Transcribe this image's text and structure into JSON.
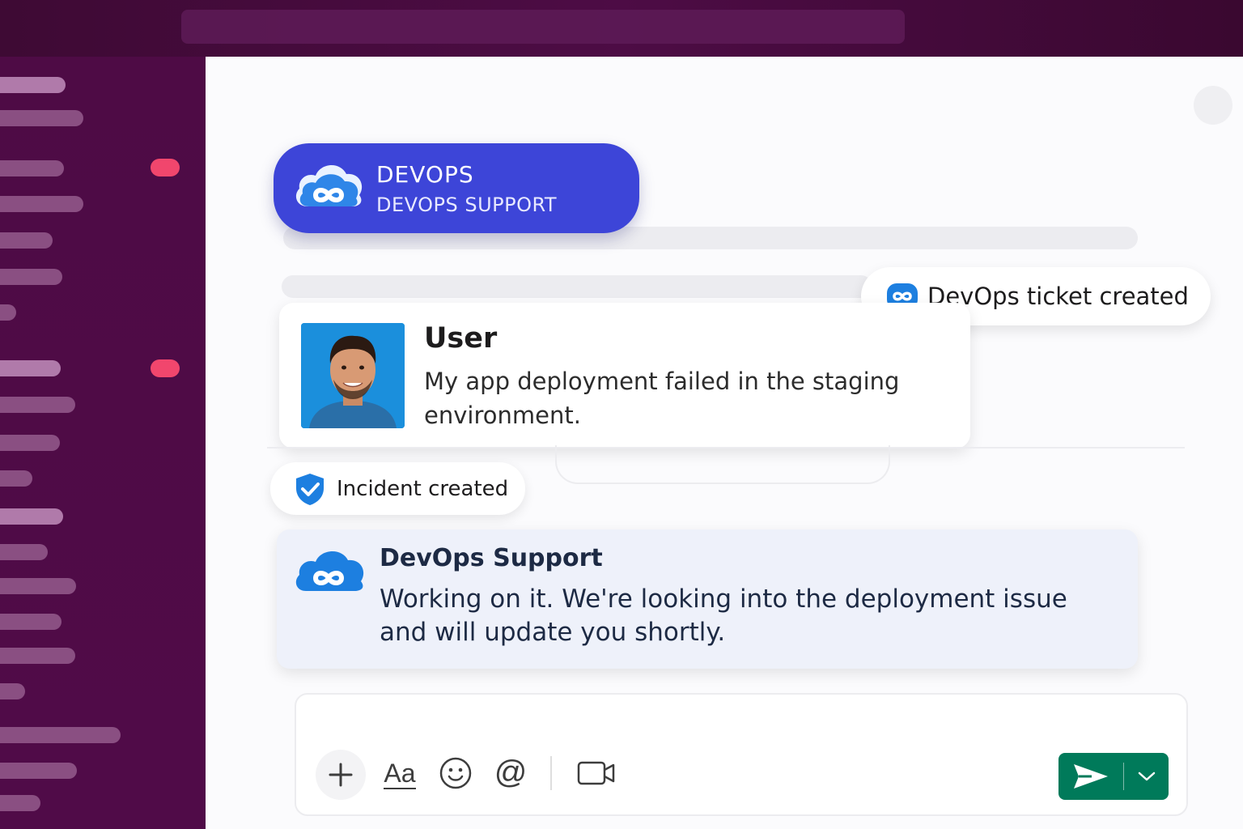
{
  "channel": {
    "title": "DEVOPS",
    "subtitle": "DEVOPS SUPPORT"
  },
  "ticket_chip": {
    "icon": "devops-cloud-icon",
    "label": "DevOps ticket created"
  },
  "user_message": {
    "author": "User",
    "avatar": "user-photo",
    "text": "My app deployment failed in the staging environment."
  },
  "incident_chip": {
    "icon": "shield-check-icon",
    "label": "Incident created"
  },
  "support_message": {
    "author": "DevOps Support",
    "icon": "devops-cloud-icon",
    "text": "Working on it. We're looking into the deployment issue and will update you shortly."
  },
  "composer": {
    "placeholder": "",
    "format_label": "Aa",
    "mention_label": "@",
    "tools": [
      "plus-icon",
      "format-icon",
      "emoji-icon",
      "mention-icon",
      "video-icon"
    ]
  },
  "colors": {
    "channel_pill": "#3d45d8",
    "sidebar": "#4e0b45",
    "badge": "#f1466d",
    "send_button": "#007a5a",
    "support_card": "#eef1fa",
    "brand_blue": "#1d7fe0"
  }
}
